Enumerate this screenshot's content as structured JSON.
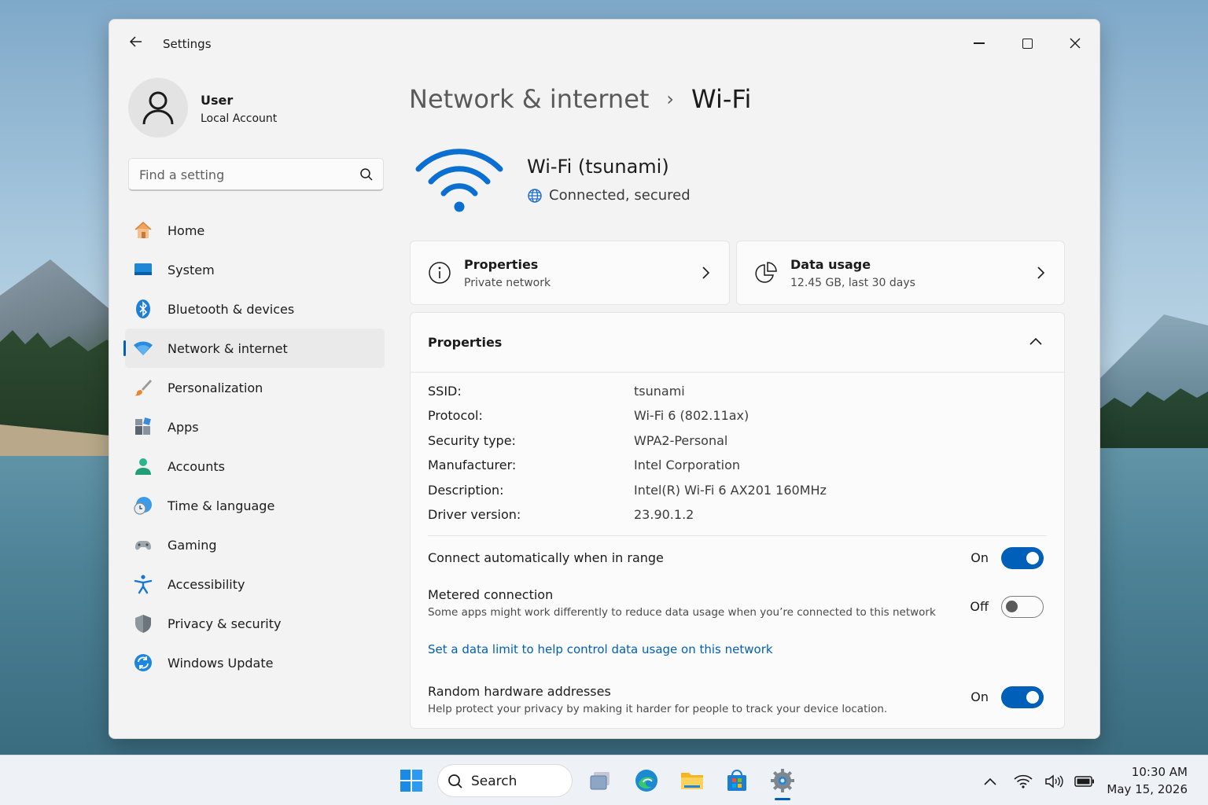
{
  "window": {
    "title": "Settings"
  },
  "user": {
    "name": "User",
    "account_type": "Local Account"
  },
  "search": {
    "placeholder": "Find a setting"
  },
  "sidebar": {
    "items": [
      {
        "label": "Home",
        "icon": "home-icon"
      },
      {
        "label": "System",
        "icon": "system-icon"
      },
      {
        "label": "Bluetooth & devices",
        "icon": "bluetooth-icon"
      },
      {
        "label": "Network & internet",
        "icon": "wifi-icon",
        "active": true
      },
      {
        "label": "Personalization",
        "icon": "brush-icon"
      },
      {
        "label": "Apps",
        "icon": "apps-icon"
      },
      {
        "label": "Accounts",
        "icon": "accounts-icon"
      },
      {
        "label": "Time & language",
        "icon": "clock-globe-icon"
      },
      {
        "label": "Gaming",
        "icon": "gamepad-icon"
      },
      {
        "label": "Accessibility",
        "icon": "accessibility-icon"
      },
      {
        "label": "Privacy & security",
        "icon": "shield-icon"
      },
      {
        "label": "Windows Update",
        "icon": "update-icon"
      }
    ]
  },
  "breadcrumb": {
    "parent": "Network & internet",
    "separator": "›",
    "current": "Wi-Fi"
  },
  "network": {
    "name": "Wi-Fi (tsunami)",
    "status": "Connected, secured"
  },
  "cards": {
    "properties": {
      "title": "Properties",
      "subtitle": "Private network"
    },
    "data_usage": {
      "title": "Data usage",
      "subtitle": "12.45 GB, last 30 days"
    }
  },
  "properties_panel": {
    "title": "Properties",
    "rows": [
      {
        "label": "SSID:",
        "value": "tsunami"
      },
      {
        "label": "Protocol:",
        "value": "Wi-Fi 6 (802.11ax)"
      },
      {
        "label": "Security type:",
        "value": "WPA2-Personal"
      },
      {
        "label": "Manufacturer:",
        "value": "Intel Corporation"
      },
      {
        "label": "Description:",
        "value": "Intel(R) Wi-Fi 6 AX201 160MHz"
      },
      {
        "label": "Driver version:",
        "value": "23.90.1.2"
      }
    ]
  },
  "settings": {
    "auto_connect": {
      "title": "Connect automatically when in range",
      "state": "On",
      "enabled": true
    },
    "metered": {
      "title": "Metered connection",
      "description": "Some apps might work differently to reduce data usage when you’re connected to this network",
      "state": "Off",
      "enabled": false
    },
    "data_limit_link": "Set a data limit to help control data usage on this network",
    "random_hw": {
      "title": "Random hardware addresses",
      "description": "Help protect your privacy by making it harder for people to track your device location.",
      "state": "On",
      "enabled": true
    }
  },
  "taskbar": {
    "search_label": "Search",
    "time": "10:30 AM",
    "date": "May 15, 2026"
  },
  "colors": {
    "accent": "#005fb8",
    "window_bg": "#f3f3f3",
    "card_bg": "#fbfbfb"
  }
}
